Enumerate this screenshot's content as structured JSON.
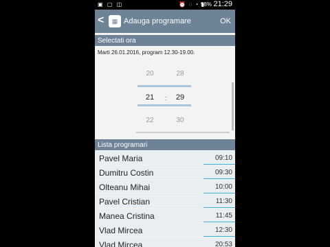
{
  "status": {
    "time": "21:29",
    "battery": "98%"
  },
  "actionbar": {
    "back": "<",
    "title": "Adauga programare",
    "ok": "OK",
    "icon": "calendar-icon"
  },
  "section_time": {
    "title": "Selectati ora"
  },
  "date_info": "Marti 26.01.2016, program 12.30-19.00.",
  "picker": {
    "hours": {
      "prev": "20",
      "selected": "21",
      "next": "22"
    },
    "minutes": {
      "prev": "28",
      "selected": "29",
      "next": "30"
    },
    "separator": ":"
  },
  "section_list": {
    "title": "Lista programari"
  },
  "appointments": [
    {
      "name": "Pavel Maria",
      "time": "09:10"
    },
    {
      "name": "Dumitru Costin",
      "time": "09:30"
    },
    {
      "name": "Olteanu Mihai",
      "time": "10:00"
    },
    {
      "name": "Pavel Cristian",
      "time": "11:30"
    },
    {
      "name": "Manea Cristina",
      "time": "11:45"
    },
    {
      "name": "Vlad Mircea",
      "time": "12:30"
    },
    {
      "name": "Vlad Mircea",
      "time": "20:53"
    }
  ]
}
